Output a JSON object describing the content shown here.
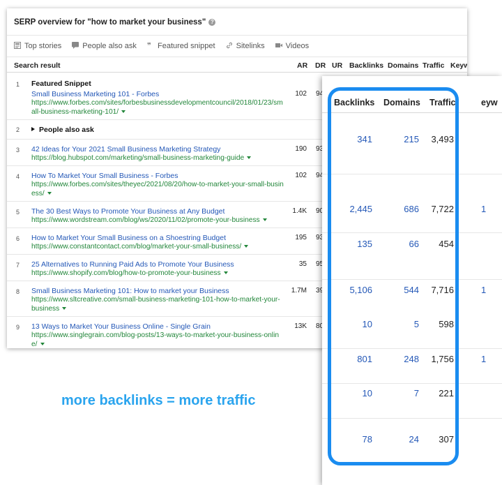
{
  "panel": {
    "title": "SERP overview for \"how to market your business\"",
    "features": [
      {
        "icon": "top-stories-icon",
        "label": "Top stories"
      },
      {
        "icon": "people-also-ask-icon",
        "label": "People also ask"
      },
      {
        "icon": "featured-snippet-icon",
        "label": "Featured snippet"
      },
      {
        "icon": "sitelinks-icon",
        "label": "Sitelinks"
      },
      {
        "icon": "videos-icon",
        "label": "Videos"
      }
    ],
    "columns": {
      "search_result": "Search result",
      "ar": "AR",
      "dr": "DR",
      "ur": "UR",
      "backlinks": "Backlinks",
      "domains": "Domains",
      "traffic": "Traffic",
      "keywords": "Keyw"
    },
    "rows": [
      {
        "num": "1",
        "heading": "Featured Snippet",
        "title": "Small Business Marketing 101 - Forbes",
        "url": "https://www.forbes.com/sites/forbesbusinessdevelopmentcouncil/2018/01/23/small-business-marketing-101/",
        "ar": "102",
        "dr": "94"
      },
      {
        "num": "2",
        "title": "People also ask"
      },
      {
        "num": "3",
        "title": "42 Ideas for Your 2021 Small Business Marketing Strategy",
        "url": "https://blog.hubspot.com/marketing/small-business-marketing-guide",
        "ar": "190",
        "dr": "93"
      },
      {
        "num": "4",
        "title": "How To Market Your Small Business - Forbes",
        "url": "https://www.forbes.com/sites/theyec/2021/08/20/how-to-market-your-small-business/",
        "ar": "102",
        "dr": "94"
      },
      {
        "num": "5",
        "title": "The 30 Best Ways to Promote Your Business at Any Budget",
        "url": "https://www.wordstream.com/blog/ws/2020/11/02/promote-your-business",
        "ar": "1.4K",
        "dr": "90"
      },
      {
        "num": "6",
        "title": "How to Market Your Small Business on a Shoestring Budget",
        "url": "https://www.constantcontact.com/blog/market-your-small-business/",
        "ar": "195",
        "dr": "93"
      },
      {
        "num": "7",
        "title": "25 Alternatives to Running Paid Ads to Promote Your Business",
        "url": "https://www.shopify.com/blog/how-to-promote-your-business",
        "ar": "35",
        "dr": "95"
      },
      {
        "num": "8",
        "title": "Small Business Marketing 101: How to market your Business",
        "url": "https://www.sltcreative.com/small-business-marketing-101-how-to-market-your-business",
        "ar": "1.7M",
        "dr": "39"
      },
      {
        "num": "9",
        "title": "13 Ways to Market Your Business Online - Single Grain",
        "url": "https://www.singlegrain.com/blog-posts/13-ways-to-market-your-business-online/",
        "ar": "13K",
        "dr": "80"
      }
    ]
  },
  "caption": "more backlinks = more traffic",
  "zoom": {
    "headers": {
      "backlinks": "Backlinks",
      "domains": "Domains",
      "traffic": "Traffic",
      "keywords": "eyw"
    },
    "rows": [
      {
        "backlinks": "341",
        "domains": "215",
        "traffic": "3,493",
        "extra": ""
      },
      {
        "backlinks": "2,445",
        "domains": "686",
        "traffic": "7,722",
        "extra": "1"
      },
      {
        "backlinks": "135",
        "domains": "66",
        "traffic": "454",
        "extra": ""
      },
      {
        "backlinks": "5,106",
        "domains": "544",
        "traffic": "7,716",
        "extra": "1"
      },
      {
        "backlinks": "10",
        "domains": "5",
        "traffic": "598",
        "extra": ""
      },
      {
        "backlinks": "801",
        "domains": "248",
        "traffic": "1,756",
        "extra": "1"
      },
      {
        "backlinks": "10",
        "domains": "7",
        "traffic": "221",
        "extra": ""
      },
      {
        "backlinks": "78",
        "domains": "24",
        "traffic": "307",
        "extra": ""
      }
    ]
  },
  "colors": {
    "link": "#2458b7",
    "url": "#22863a",
    "accent": "#1a8cf0",
    "caption": "#2aa4ee"
  }
}
